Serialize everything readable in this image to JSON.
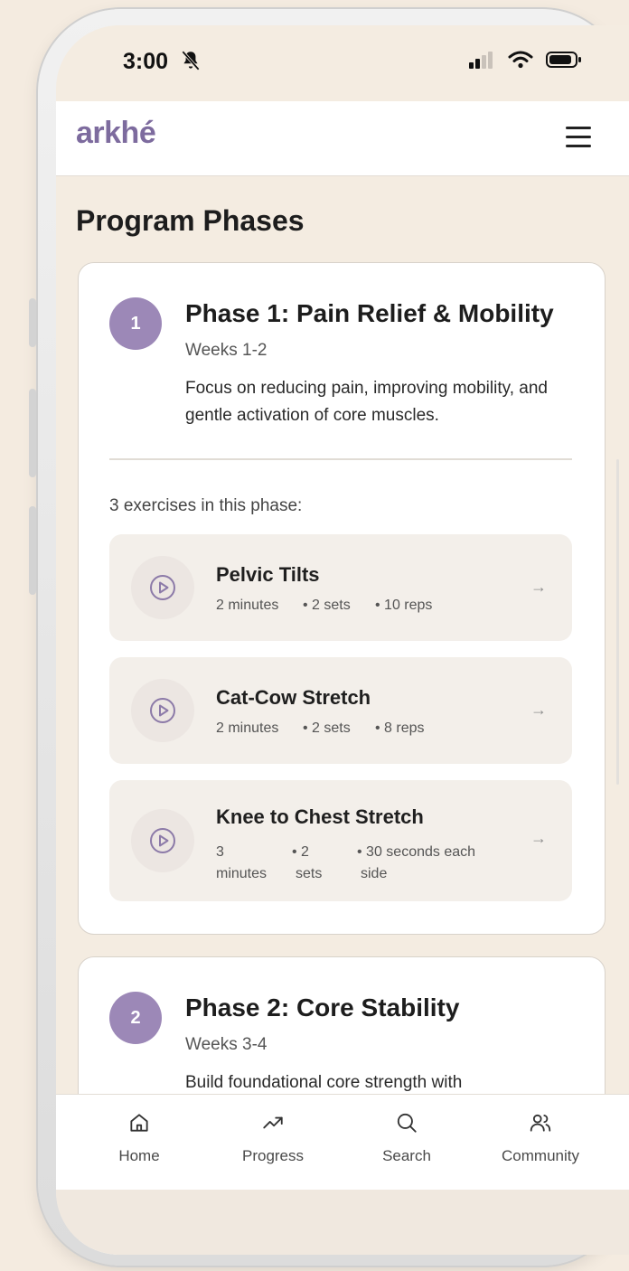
{
  "status_bar": {
    "time": "3:00"
  },
  "header": {
    "logo": "arkhé"
  },
  "page_title": "Program Phases",
  "phases": [
    {
      "number": "1",
      "title": "Phase 1: Pain Relief & Mobility",
      "weeks": "Weeks 1-2",
      "description": "Focus on reducing pain, improving mobility, and gentle activation of core muscles.",
      "exercise_count_label": "3 exercises in this phase:",
      "exercises": [
        {
          "name": "Pelvic Tilts",
          "duration": "2 minutes",
          "sets": "• 2 sets",
          "reps": "• 10 reps"
        },
        {
          "name": "Cat-Cow Stretch",
          "duration": "2 minutes",
          "sets": "• 2 sets",
          "reps": "• 8 reps"
        },
        {
          "name": "Knee to Chest Stretch",
          "duration_line1": "3",
          "duration_line2": "minutes",
          "sets_line1": "• 2",
          "sets_line2": "sets",
          "reps_line1": "• 30 seconds each",
          "reps_line2": "side"
        }
      ]
    },
    {
      "number": "2",
      "title": "Phase 2: Core Stability",
      "weeks": "Weeks 3-4",
      "description": "Build foundational core strength with"
    }
  ],
  "tabs": [
    {
      "label": "Home",
      "icon": "home-icon"
    },
    {
      "label": "Progress",
      "icon": "trending-up-icon"
    },
    {
      "label": "Search",
      "icon": "search-icon"
    },
    {
      "label": "Community",
      "icon": "users-icon"
    }
  ],
  "colors": {
    "accent": "#9c88b7",
    "logo": "#7d6b9e",
    "background": "#f4ece1",
    "exercise_bg": "#f3efea"
  },
  "arrow_glyph": "→"
}
